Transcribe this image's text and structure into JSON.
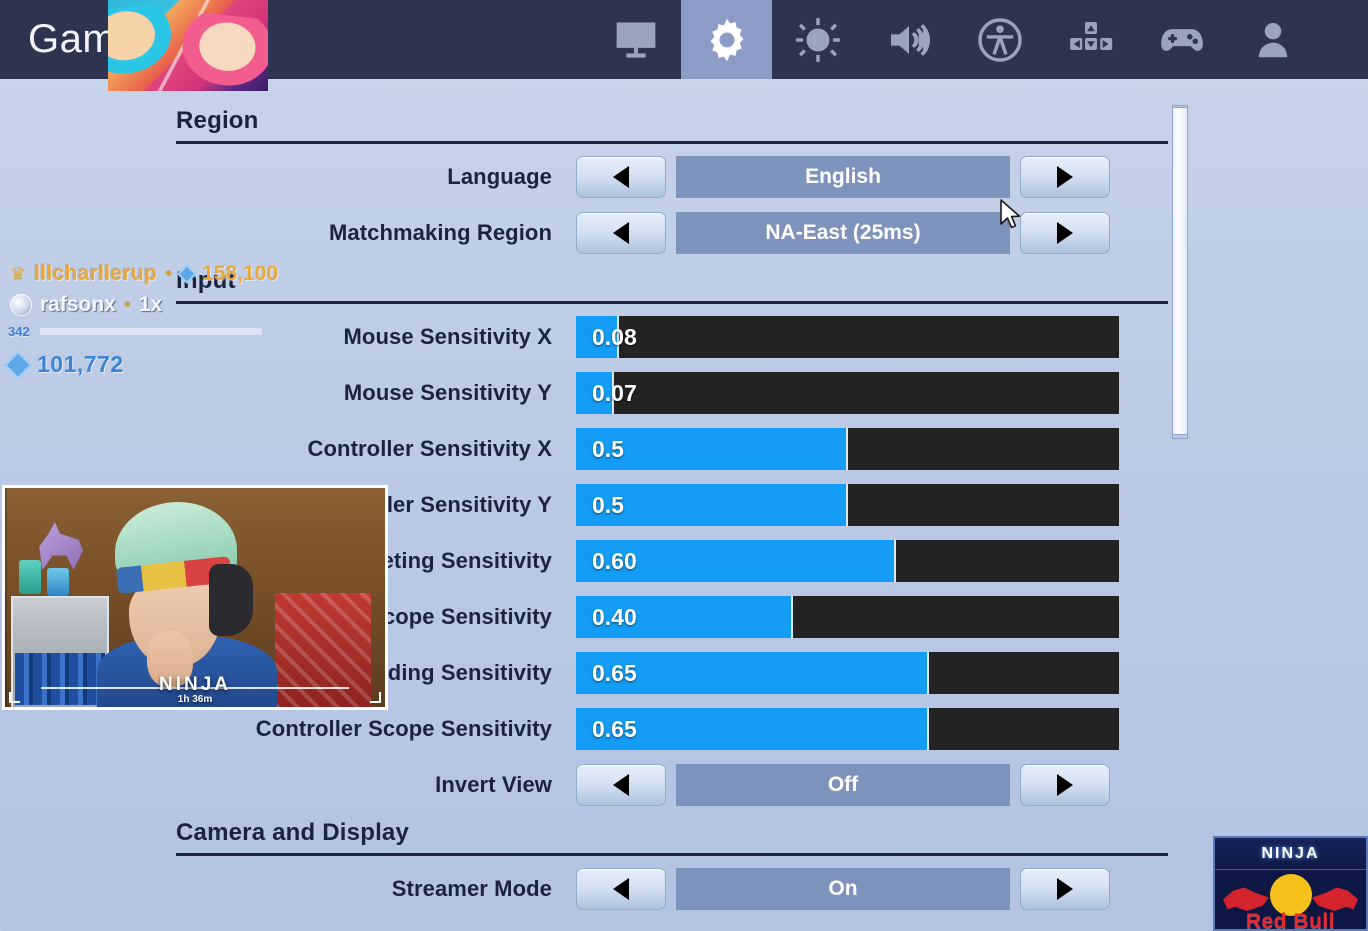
{
  "topbar": {
    "title": "Gam",
    "nav_items": [
      {
        "icon": "monitor-icon",
        "name": "video",
        "selected": false
      },
      {
        "icon": "gear-icon",
        "name": "game",
        "selected": true
      },
      {
        "icon": "brightness-icon",
        "name": "brightness",
        "selected": false
      },
      {
        "icon": "speaker-icon",
        "name": "audio",
        "selected": false
      },
      {
        "icon": "accessibility-icon",
        "name": "accessibility",
        "selected": false
      },
      {
        "icon": "keybinds-icon",
        "name": "keyboard",
        "selected": false
      },
      {
        "icon": "controller-icon",
        "name": "controller",
        "selected": false
      },
      {
        "icon": "account-icon",
        "name": "account",
        "selected": false
      }
    ]
  },
  "sections": {
    "region": {
      "title": "Region",
      "rows": [
        {
          "label": "Language",
          "value": "English"
        },
        {
          "label": "Matchmaking Region",
          "value": "NA-East (25ms)"
        }
      ]
    },
    "input": {
      "title": "Input",
      "sliders": [
        {
          "label": "Mouse Sensitivity X",
          "value": "0.08",
          "fill_pct": 8
        },
        {
          "label": "Mouse Sensitivity Y",
          "value": "0.07",
          "fill_pct": 7
        },
        {
          "label": "Controller Sensitivity X",
          "value": "0.5",
          "fill_pct": 50
        },
        {
          "label": "Controller Sensitivity Y",
          "value": "0.5",
          "fill_pct": 50
        },
        {
          "label": "Controller Targeting Sensitivity",
          "value": "0.60",
          "fill_pct": 59
        },
        {
          "label": "Controller Scope Sensitivity",
          "value": "0.40",
          "fill_pct": 40
        },
        {
          "label": "Controller Building Sensitivity",
          "value": "0.65",
          "fill_pct": 65
        },
        {
          "label": "Controller Scope Sensitivity",
          "value": "0.65",
          "fill_pct": 65
        }
      ],
      "invert_view": {
        "label": "Invert View",
        "value": "Off"
      }
    },
    "camera_and_display": {
      "title": "Camera and Display",
      "rows": [
        {
          "label": "Streamer Mode",
          "value": "On"
        }
      ]
    }
  },
  "overlay": {
    "gift_line": {
      "crown": "crown-icon",
      "name": "lllcharllerup",
      "sep": "•",
      "amount": "158,100"
    },
    "sub_line": {
      "avatar": "avatar-icon",
      "name": "rafsonx",
      "sep": "•",
      "multiplier": "1x"
    },
    "progress": {
      "label": "342",
      "fill_pct": 92
    },
    "points": {
      "icon": "gem-icon",
      "value": "101,772"
    }
  },
  "webcam": {
    "brand": "NINJA",
    "uptime": "1h 36m"
  },
  "sponsor": {
    "brand": "NINJA",
    "partner": "Red Bull"
  },
  "colors": {
    "topbar_bg": "#2e3350",
    "tab_selected_bg": "#8c9cc6",
    "panel_bg": "#c2cfe8",
    "slider_fill": "#129cf3",
    "slider_track": "#232323",
    "value_box": "#7d93bb",
    "header_text": "#1c2340",
    "overlay_gold": "#e8a83a",
    "overlay_blue": "#3c86d4"
  }
}
